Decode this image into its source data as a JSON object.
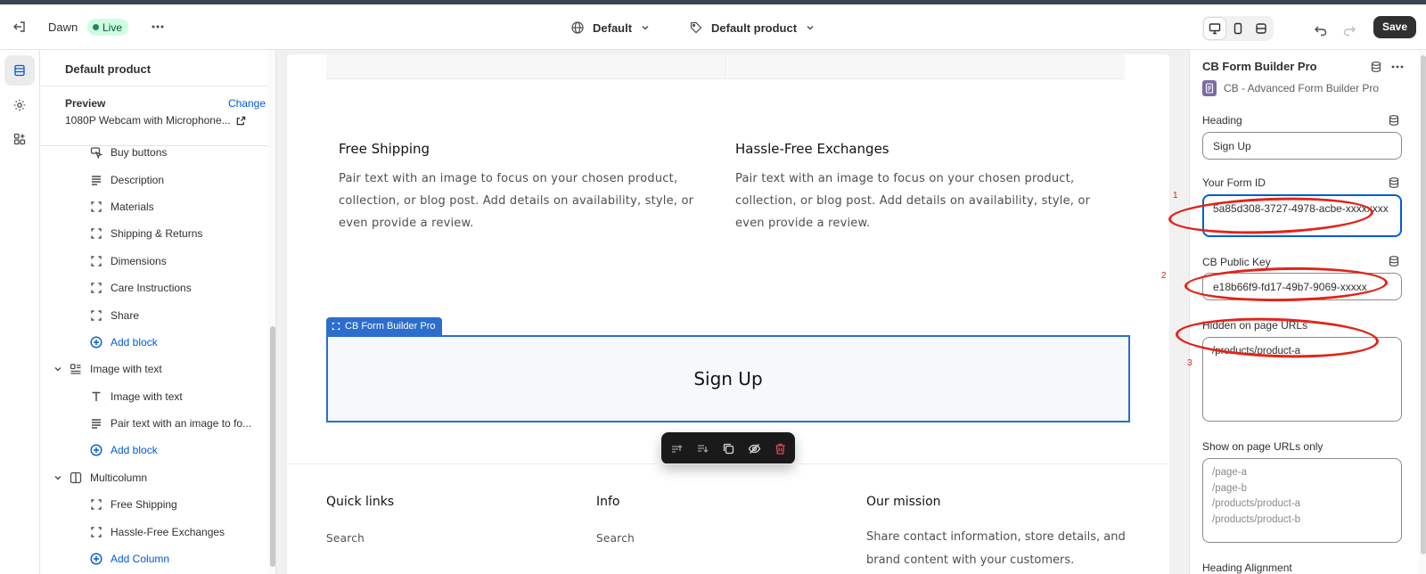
{
  "topbar": {
    "theme_name": "Dawn",
    "live_badge": "Live",
    "locale_selector": "Default",
    "template_selector": "Default product",
    "save_label": "Save"
  },
  "sidebar": {
    "title": "Default product",
    "preview_label": "Preview",
    "change_link": "Change",
    "preview_product": "1080P Webcam with Microphone...",
    "items": [
      {
        "label": "Buy buttons"
      },
      {
        "label": "Description"
      },
      {
        "label": "Materials"
      },
      {
        "label": "Shipping & Returns"
      },
      {
        "label": "Dimensions"
      },
      {
        "label": "Care Instructions"
      },
      {
        "label": "Share"
      },
      {
        "label": "Add block"
      },
      {
        "label": "Image with text"
      },
      {
        "label": "Image with text"
      },
      {
        "label": "Pair text with an image to fo..."
      },
      {
        "label": "Add block"
      },
      {
        "label": "Multicolumn"
      },
      {
        "label": "Free Shipping"
      },
      {
        "label": "Hassle-Free Exchanges"
      },
      {
        "label": "Add Column"
      }
    ]
  },
  "canvas": {
    "columns": [
      {
        "title": "Free Shipping",
        "text": "Pair text with an image to focus on your chosen product, collection, or blog post. Add details on availability, style, or even provide a review."
      },
      {
        "title": "Hassle-Free Exchanges",
        "text": "Pair text with an image to focus on your chosen product, collection, or blog post. Add details on availability, style, or even provide a review."
      }
    ],
    "block_tag": "CB Form Builder Pro",
    "block_heading": "Sign Up",
    "footer": {
      "quick_links_title": "Quick links",
      "quick_links_item": "Search",
      "info_title": "Info",
      "info_item": "Search",
      "mission_title": "Our mission",
      "mission_text": "Share contact information, store details, and brand content with your customers."
    }
  },
  "panel": {
    "title": "CB Form Builder Pro",
    "app_name": "CB - Advanced Form Builder Pro",
    "heading_label": "Heading",
    "heading_value": "Sign Up",
    "form_id_label": "Your Form ID",
    "form_id_value": "5a85d308-3727-4978-acbe-xxxxxxxx",
    "public_key_label": "CB Public Key",
    "public_key_value": "e18b66f9-fd17-49b7-9069-xxxxx",
    "hidden_label": "Hidden on page URLs",
    "hidden_value": "/products/product-a",
    "show_label": "Show on page URLs only",
    "show_placeholder": [
      "/page-a",
      "/page-b",
      "/products/product-a",
      "/products/product-b"
    ],
    "alignment_label": "Heading Alignment"
  },
  "annotations": [
    "1",
    "2",
    "3"
  ],
  "colors": {
    "accent": "#005bd3",
    "annotation": "#e0241a",
    "live": "#29845a",
    "block_selected": "#2c6ecb"
  }
}
